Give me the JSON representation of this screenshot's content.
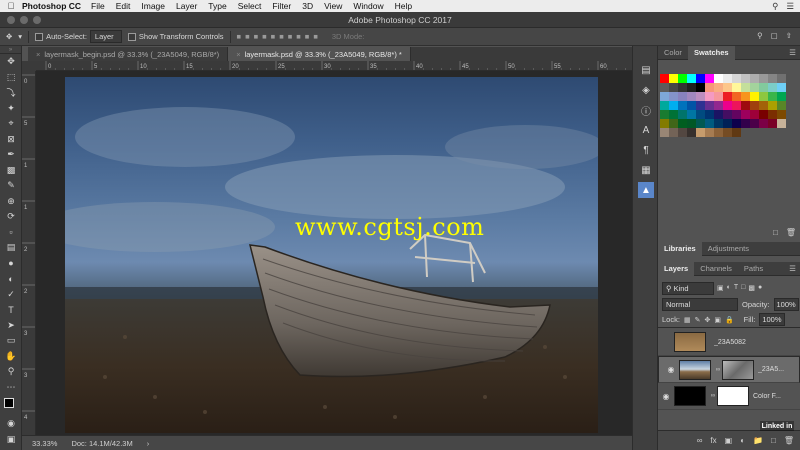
{
  "menubar": {
    "app_name": "Photoshop CC",
    "items": [
      "File",
      "Edit",
      "Image",
      "Layer",
      "Type",
      "Select",
      "Filter",
      "3D",
      "View",
      "Window",
      "Help"
    ]
  },
  "window": {
    "title": "Adobe Photoshop CC 2017"
  },
  "options": {
    "auto_select_label": "Auto-Select:",
    "auto_select_value": "Layer",
    "transform_label": "Show Transform Controls",
    "mode_label": "3D Mode:"
  },
  "tabs": [
    {
      "label": "layermask_begin.psd @ 33.3% (_23A5049, RGB/8*)"
    },
    {
      "label": "layermask.psd @ 33.3% (_23A5049, RGB/8*) *"
    }
  ],
  "rulers": {
    "top": [
      "0",
      "5",
      "10",
      "15",
      "20",
      "25",
      "30",
      "35",
      "40",
      "45",
      "50",
      "55",
      "60"
    ],
    "left": [
      "0",
      "5",
      "1",
      "1",
      "2",
      "2",
      "3",
      "3",
      "4"
    ]
  },
  "canvas": {
    "watermark": "www.cgtsj.com"
  },
  "status": {
    "zoom": "33.33%",
    "doc": "Doc: 14.1M/42.3M"
  },
  "color_panel": {
    "tab_color": "Color",
    "tab_swatches": "Swatches"
  },
  "swatches": [
    "#ff0000",
    "#ffff00",
    "#00ff00",
    "#00ffff",
    "#0000ff",
    "#ff00ff",
    "#ffffff",
    "#ebebeb",
    "#d6d6d6",
    "#c2c2c2",
    "#adadad",
    "#999999",
    "#858585",
    "#707070",
    "#5c5c5c",
    "#474747",
    "#333333",
    "#1f1f1f",
    "#000000",
    "#f7977a",
    "#f9ad81",
    "#fdc68a",
    "#fff79a",
    "#c4df9b",
    "#a3d39c",
    "#82ca9d",
    "#7bcdc8",
    "#6ecff6",
    "#7ea7d8",
    "#8493ca",
    "#8882be",
    "#a187be",
    "#bc8dbf",
    "#f49ac2",
    "#f6989d",
    "#ed1c24",
    "#f26522",
    "#f7941d",
    "#fff200",
    "#8dc73f",
    "#39b54a",
    "#00a651",
    "#00a99d",
    "#00aeef",
    "#0072bc",
    "#0054a6",
    "#2e3192",
    "#662d91",
    "#92278f",
    "#ec008c",
    "#ed145b",
    "#9e0b0f",
    "#a0410d",
    "#a36209",
    "#aba000",
    "#598527",
    "#197b30",
    "#007236",
    "#00746b",
    "#0076a3",
    "#004b80",
    "#003471",
    "#1b1464",
    "#440e62",
    "#630460",
    "#9e005d",
    "#9e0039",
    "#790000",
    "#7b2e00",
    "#7d4900",
    "#827b00",
    "#406618",
    "#005e20",
    "#005826",
    "#005952",
    "#005b7f",
    "#003663",
    "#002157",
    "#0d004c",
    "#32004b",
    "#4b0049",
    "#7b0046",
    "#7a0026",
    "#c7b299",
    "#998675",
    "#736357",
    "#534741",
    "#37302d",
    "#c69c6d",
    "#a67c52",
    "#8c6239",
    "#754c24",
    "#603913"
  ],
  "libraries_panel": {
    "tab_libraries": "Libraries",
    "tab_adjustments": "Adjustments"
  },
  "layers_panel": {
    "tab_layers": "Layers",
    "tab_channels": "Channels",
    "tab_paths": "Paths",
    "kind_label": "Kind",
    "blend_mode": "Normal",
    "opacity_label": "Opacity:",
    "opacity_value": "100%",
    "lock_label": "Lock:",
    "fill_label": "Fill:",
    "fill_value": "100%",
    "layers": [
      {
        "name": "_23A5082",
        "visible": false,
        "selected": false,
        "thumb_color": "#a07a4a",
        "has_mask": false
      },
      {
        "name": "_23A5...",
        "visible": true,
        "selected": true,
        "thumb_color": "#6a7f9a",
        "has_mask": true,
        "mask_color": "#9a9a9a"
      },
      {
        "name": "Color F...",
        "visible": true,
        "selected": false,
        "thumb_color": "#000000",
        "has_mask": true,
        "mask_color": "#ffffff"
      }
    ]
  },
  "watermark_brand": "Linked in"
}
